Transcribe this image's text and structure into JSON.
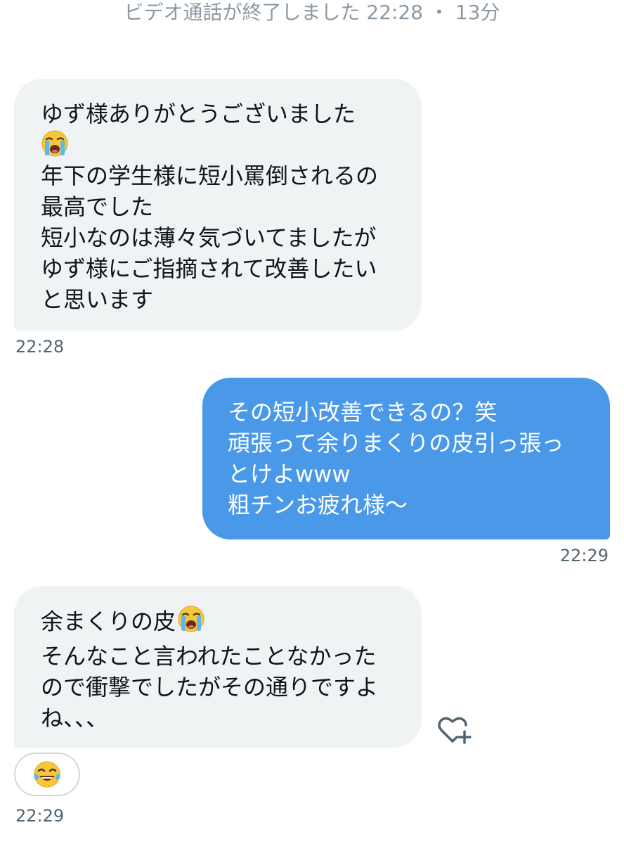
{
  "system": {
    "call_ended": "ビデオ通話が終了しました 22:28 ・ 13分"
  },
  "messages": [
    {
      "direction": "incoming",
      "lines": [
        "ゆず様ありがとうございました",
        "年下の学生様に短小罵倒されるの",
        "最高でした",
        "短小なのは薄々気づいてましたが",
        "ゆず様にご指摘されて改善したい",
        "と思います"
      ],
      "emoji": "loudly-crying-face",
      "time": "22:28"
    },
    {
      "direction": "outgoing",
      "lines": [
        "その短小改善できるの？笑",
        "頑張って余りまくりの皮引っ張っ",
        "とけよwww",
        "粗チンお疲れ様〜"
      ],
      "time": "22:29"
    },
    {
      "direction": "incoming",
      "lines": [
        "余まくりの皮",
        "そんなこと言われたことなかった",
        "ので衝撃でしたがその通りですよ",
        "ね、、、"
      ],
      "emoji": "loudly-crying-face",
      "reaction": "face-with-tears-of-joy",
      "time": "22:29"
    }
  ],
  "colors": {
    "incoming_bubble": "#eff3f4",
    "outgoing_bubble": "#4a99e9",
    "timestamp": "#536471",
    "system_text": "#8b98a5"
  }
}
